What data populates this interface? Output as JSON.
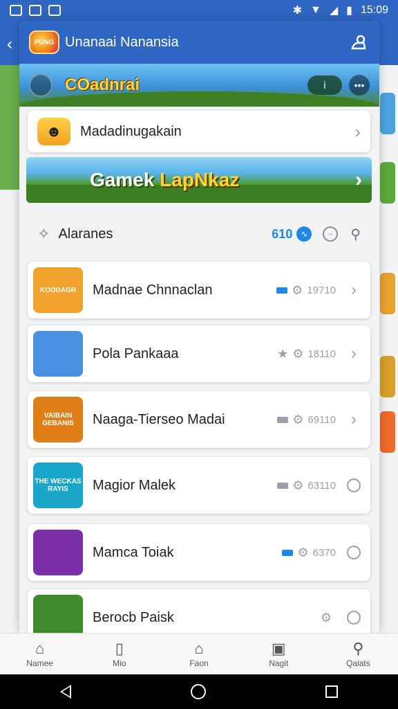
{
  "status_bar": {
    "time": "15:09"
  },
  "sheet": {
    "title": "Unanaai Nanansia",
    "logo_text": "PUNG",
    "banner_title": "COadnrai",
    "promo_label": "Madadinugakain",
    "game_banner": {
      "part1": "Gamek ",
      "part2": "LapNkaz"
    },
    "section": {
      "label": "Alaranes",
      "count": "610"
    }
  },
  "games": [
    {
      "name": "Madnae Chnnaclan",
      "meta": "19710",
      "tag": "blue",
      "action": "chevron",
      "thumb_text": "KOODAGR",
      "thumb_color": "#f0a22c"
    },
    {
      "name": "Pola Pankaaa",
      "meta": "18110",
      "tag": "star",
      "action": "chevron",
      "thumb_text": "",
      "thumb_color": "#4a90e2"
    },
    {
      "name": "Naaga-Tierseo Madai",
      "meta": "69110",
      "tag": "gray",
      "action": "chevron",
      "thumb_text": "VAIBAIN GEBANIS",
      "thumb_color": "#e07f18"
    },
    {
      "name": "Magior Malek",
      "meta": "63110",
      "tag": "gray",
      "action": "circle",
      "thumb_text": "THE WECKAS RAYIS",
      "thumb_color": "#19a6c9"
    },
    {
      "name": "Mamca Toiak",
      "meta": "6370",
      "tag": "blue",
      "action": "circle",
      "thumb_text": "",
      "thumb_color": "#7b2fa8"
    },
    {
      "name": "Berocb Paisk",
      "meta": "",
      "tag": "none",
      "action": "circle",
      "thumb_text": "",
      "thumb_color": "#3f8a2a"
    }
  ],
  "bottom_nav": [
    {
      "label": "Namee",
      "icon": "home-icon"
    },
    {
      "label": "Mio",
      "icon": "bookmark-icon"
    },
    {
      "label": "Faon",
      "icon": "house-outline-icon"
    },
    {
      "label": "Nagit",
      "icon": "inbox-icon"
    },
    {
      "label": "Qaiats",
      "icon": "search-icon"
    }
  ]
}
